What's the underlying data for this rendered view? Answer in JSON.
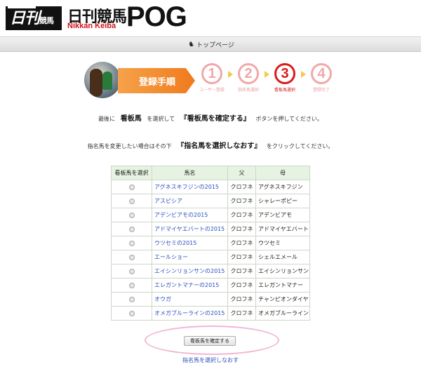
{
  "header": {
    "logo_main": "日刊",
    "logo_small": "競馬",
    "brand_jp": "日刊競馬",
    "brand_en": "Nikkan Keiba",
    "brand_pog": "POG"
  },
  "nav": {
    "top_page": "トップページ"
  },
  "steps": {
    "banner": "登録手順",
    "items": [
      {
        "num": "1",
        "label": "ユーザー登録"
      },
      {
        "num": "2",
        "label": "指名馬選択"
      },
      {
        "num": "3",
        "label": "看板馬選択"
      },
      {
        "num": "4",
        "label": "登録完了"
      }
    ],
    "active": 3
  },
  "instructions": {
    "line1_a": "最後に",
    "line1_b": "看板馬",
    "line1_c": "を選択して",
    "line1_d": "『看板馬を確定する』",
    "line1_e": "ボタンを押してください。",
    "line2_a": "指名馬を変更したい場合はその下",
    "line2_b": "『指名馬を選択しなおす』",
    "line2_c": "をクリックしてください。"
  },
  "table": {
    "headers": [
      "看板馬を選択",
      "馬名",
      "父",
      "母"
    ],
    "rows": [
      {
        "name": "アグネスキフジンの2015",
        "sire": "クロフネ",
        "dam": "アグネスキフジン"
      },
      {
        "name": "アスピシア",
        "sire": "クロフネ",
        "dam": "シャレーポピー"
      },
      {
        "name": "アデンビアモの2015",
        "sire": "クロフネ",
        "dam": "アデンビアモ"
      },
      {
        "name": "アドマイヤエバートの2015",
        "sire": "クロフネ",
        "dam": "アドマイヤエバート"
      },
      {
        "name": "ウツセミの2015",
        "sire": "クロフネ",
        "dam": "ウツセミ"
      },
      {
        "name": "エールショー",
        "sire": "クロフネ",
        "dam": "シェルエメール"
      },
      {
        "name": "エイシンリョンサンの2015",
        "sire": "クロフネ",
        "dam": "エイシンリョンサン"
      },
      {
        "name": "エレガントマナーの2015",
        "sire": "クロフネ",
        "dam": "エレガントマナー"
      },
      {
        "name": "オウガ",
        "sire": "クロフネ",
        "dam": "チャンピオンダイヤ"
      },
      {
        "name": "オメガブルーラインの2015",
        "sire": "クロフネ",
        "dam": "オメガブルーライン"
      }
    ]
  },
  "actions": {
    "confirm": "看板馬を確定する",
    "reselect": "指名馬を選択しなおす"
  }
}
